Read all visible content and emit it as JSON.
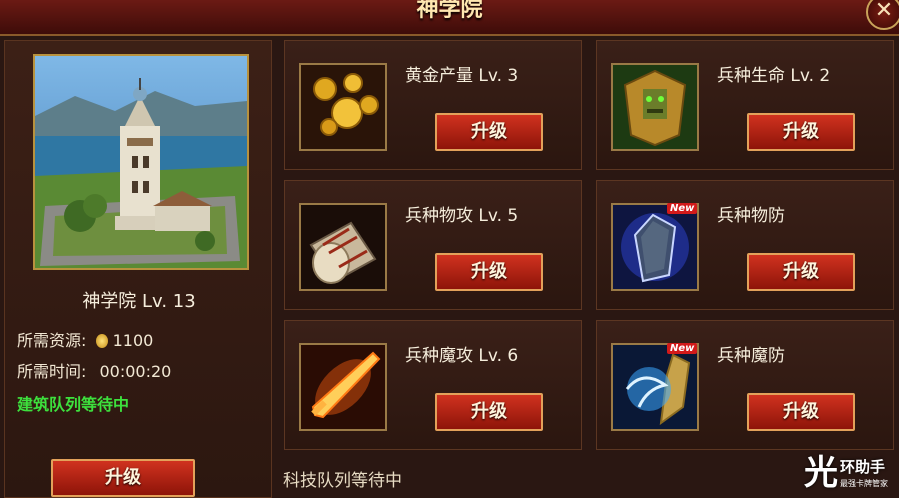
{
  "window": {
    "title": "神学院",
    "close_label": "✕"
  },
  "building": {
    "name": "神学院  Lv. 13",
    "resource_label": "所需资源:",
    "resource_value": "1100",
    "time_label": "所需时间:",
    "time_value": "00:00:20",
    "status": "建筑队列等待中",
    "upgrade_label": "升级"
  },
  "techs": [
    {
      "name": "黄金产量  Lv. 3",
      "upgrade_label": "升级",
      "icon": "gold-coins-icon"
    },
    {
      "name": "兵种生命  Lv. 2",
      "upgrade_label": "升级",
      "icon": "golden-armor-icon"
    },
    {
      "name": "兵种物攻  Lv. 5",
      "upgrade_label": "升级",
      "icon": "war-drum-icon"
    },
    {
      "name": "兵种物防",
      "upgrade_label": "升级",
      "icon": "shield-icon",
      "badge": "New"
    },
    {
      "name": "兵种魔攻  Lv. 6",
      "upgrade_label": "升级",
      "icon": "flaming-sword-icon"
    },
    {
      "name": "兵种魔防",
      "upgrade_label": "升级",
      "icon": "magic-shield-icon",
      "badge": "New"
    }
  ],
  "footer": {
    "queue_status": "科技队列等待中"
  },
  "watermark": {
    "main": "环助手",
    "sub": "最强卡牌管家"
  },
  "colors": {
    "button": "#b8230f",
    "status_green": "#3de03d",
    "frame_gold": "#b8923e"
  }
}
